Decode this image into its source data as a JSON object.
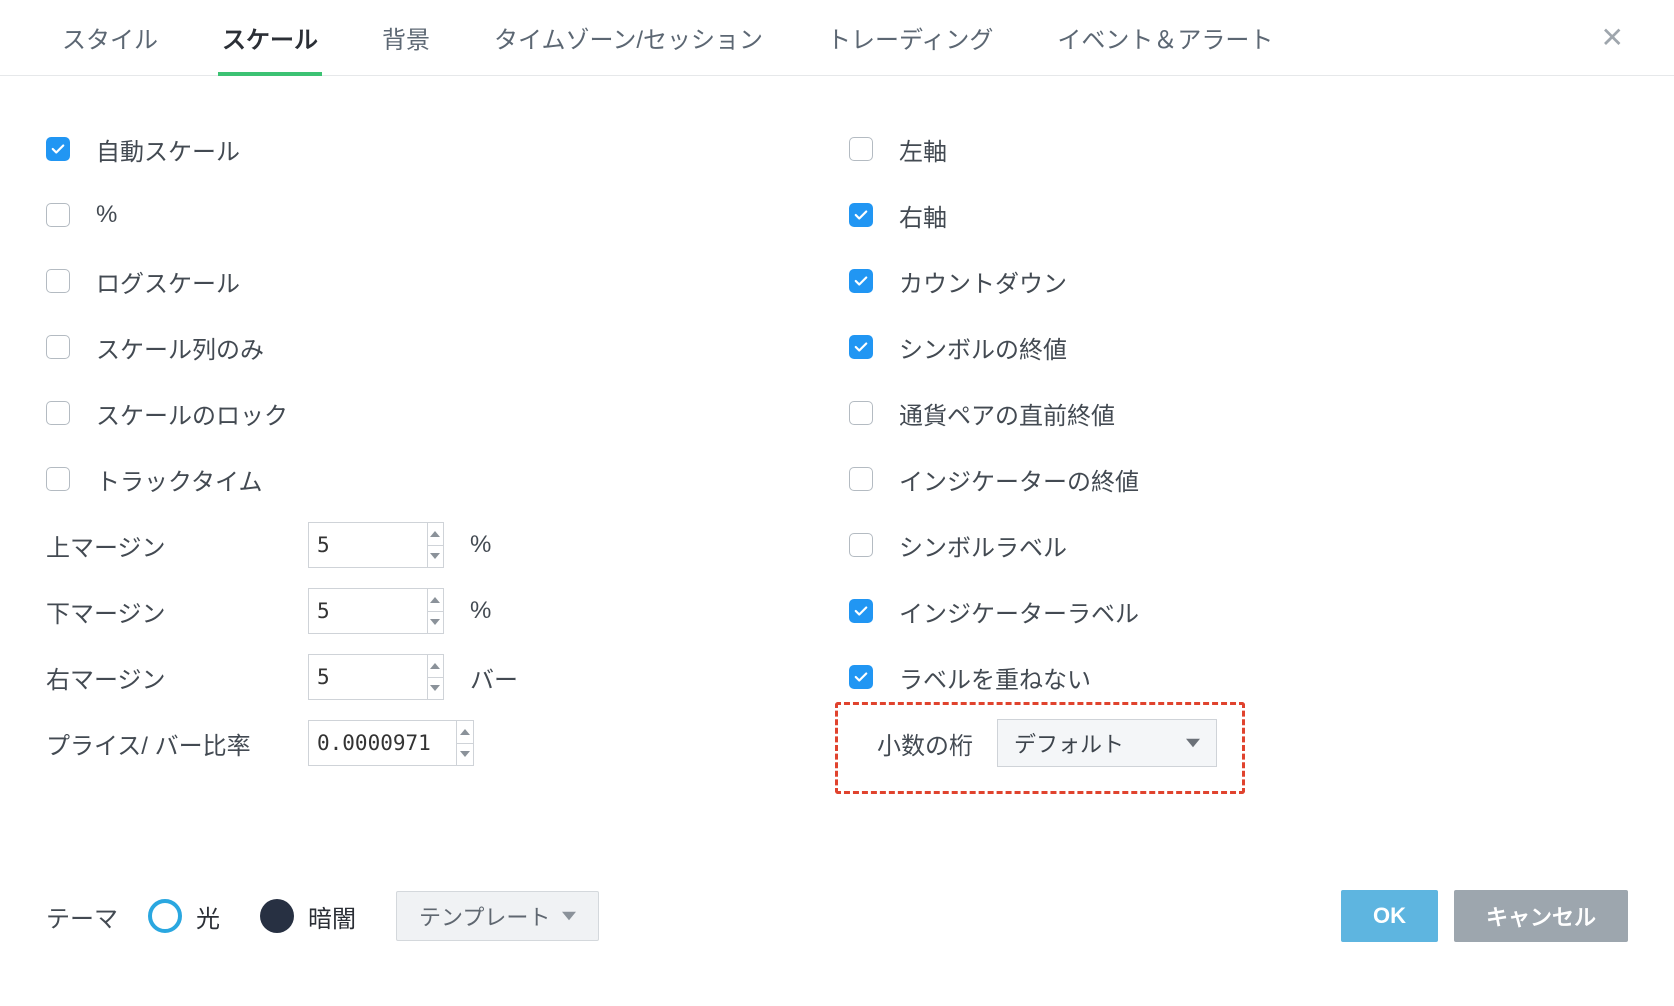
{
  "tabs": {
    "style": "スタイル",
    "scale": "スケール",
    "background": "背景",
    "timezone": "タイムゾーン/セッション",
    "trading": "トレーディング",
    "events": "イベント＆アラート"
  },
  "left": {
    "auto_scale": {
      "label": "自動スケール",
      "checked": true
    },
    "percent": {
      "label": "%",
      "checked": false
    },
    "log_scale": {
      "label": "ログスケール",
      "checked": false
    },
    "scale_series_only": {
      "label": "スケール列のみ",
      "checked": false
    },
    "lock_scale": {
      "label": "スケールのロック",
      "checked": false
    },
    "track_time": {
      "label": "トラックタイム",
      "checked": false
    },
    "top_margin": {
      "label": "上マージン",
      "value": "5",
      "unit": "%"
    },
    "bottom_margin": {
      "label": "下マージン",
      "value": "5",
      "unit": "%"
    },
    "right_margin": {
      "label": "右マージン",
      "value": "5",
      "unit": "バー"
    },
    "price_bar_ratio": {
      "label": "プライス/ バー比率",
      "value": "0.0000971"
    }
  },
  "right": {
    "left_axis": {
      "label": "左軸",
      "checked": false
    },
    "right_axis": {
      "label": "右軸",
      "checked": true
    },
    "countdown": {
      "label": "カウントダウン",
      "checked": true
    },
    "symbol_last": {
      "label": "シンボルの終値",
      "checked": true
    },
    "pair_prev_close": {
      "label": "通貨ペアの直前終値",
      "checked": false
    },
    "indicator_last": {
      "label": "インジケーターの終値",
      "checked": false
    },
    "symbol_label": {
      "label": "シンボルラベル",
      "checked": false
    },
    "indicator_label": {
      "label": "インジケーターラベル",
      "checked": true
    },
    "no_overlap": {
      "label": "ラベルを重ねない",
      "checked": true
    },
    "decimal_places": {
      "label": "小数の桁",
      "value": "デフォルト"
    }
  },
  "footer": {
    "theme_label": "テーマ",
    "light": "光",
    "dark": "暗闇",
    "template": "テンプレート",
    "ok": "OK",
    "cancel": "キャンセル"
  }
}
